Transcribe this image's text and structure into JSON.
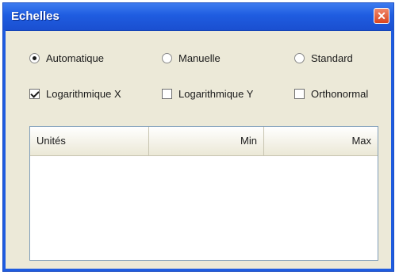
{
  "window": {
    "title": "Echelles",
    "close_icon": "close-icon"
  },
  "scale_mode": {
    "options": [
      {
        "label": "Automatique",
        "selected": true
      },
      {
        "label": "Manuelle",
        "selected": false
      },
      {
        "label": "Standard",
        "selected": false
      }
    ]
  },
  "axis_options": [
    {
      "label": "Logarithmique X",
      "checked": true
    },
    {
      "label": "Logarithmique Y",
      "checked": false
    },
    {
      "label": "Orthonormal",
      "checked": false
    }
  ],
  "table": {
    "columns": [
      "Unités",
      "Min",
      "Max"
    ],
    "rows": []
  },
  "colors": {
    "titlebar": "#1f5ce0",
    "dialog_bg": "#ece9d8",
    "close_button": "#d9441f"
  }
}
